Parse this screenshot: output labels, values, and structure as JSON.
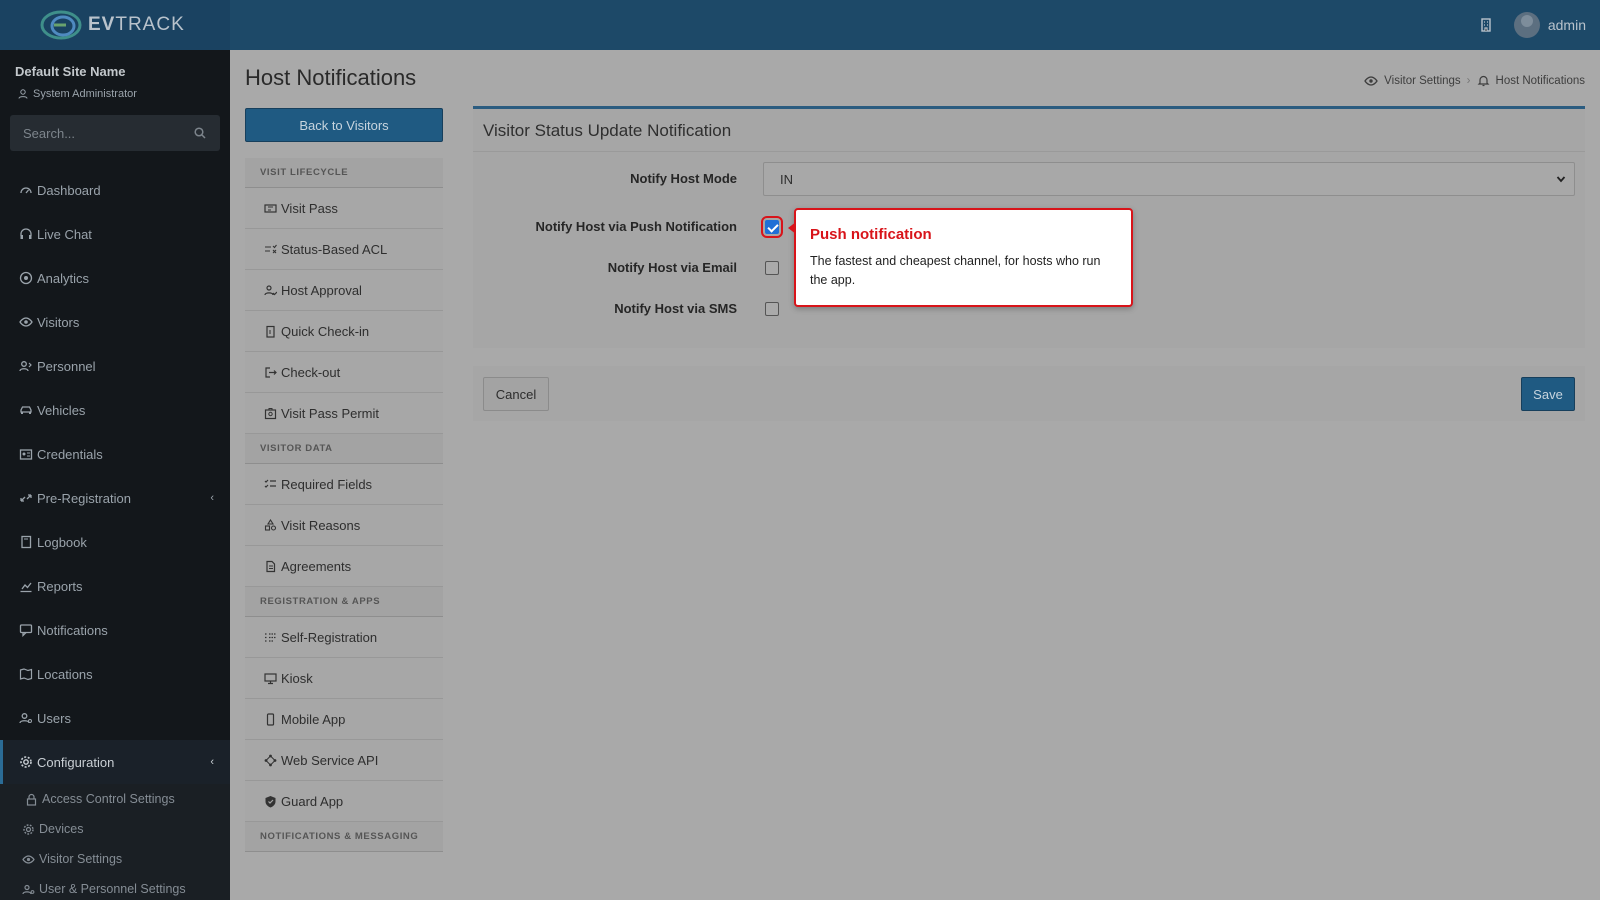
{
  "header": {
    "logo_text_bold": "EV",
    "logo_text_thin": "TRACK",
    "user_name": "admin"
  },
  "sidebar": {
    "site_name": "Default Site Name",
    "site_role": "System Administrator",
    "search_placeholder": "Search...",
    "items": [
      {
        "label": "Dashboard"
      },
      {
        "label": "Live Chat"
      },
      {
        "label": "Analytics"
      },
      {
        "label": "Visitors"
      },
      {
        "label": "Personnel"
      },
      {
        "label": "Vehicles"
      },
      {
        "label": "Credentials"
      },
      {
        "label": "Pre-Registration"
      },
      {
        "label": "Logbook"
      },
      {
        "label": "Reports"
      },
      {
        "label": "Notifications"
      },
      {
        "label": "Locations"
      },
      {
        "label": "Users"
      },
      {
        "label": "Configuration"
      }
    ],
    "config_sub": [
      {
        "label": "Access Control Settings"
      },
      {
        "label": "Devices"
      },
      {
        "label": "Visitor Settings"
      },
      {
        "label": "User & Personnel Settings"
      }
    ]
  },
  "page": {
    "title": "Host Notifications",
    "back_label": "Back to Visitors",
    "breadcrumb": [
      "Visitor Settings",
      "Host Notifications"
    ]
  },
  "submenu": {
    "sections": [
      {
        "heading": "VISIT LIFECYCLE",
        "items": [
          "Visit Pass",
          "Status-Based ACL",
          "Host Approval",
          "Quick Check-in",
          "Check-out",
          "Visit Pass Permit"
        ]
      },
      {
        "heading": "VISITOR DATA",
        "items": [
          "Required Fields",
          "Visit Reasons",
          "Agreements"
        ]
      },
      {
        "heading": "REGISTRATION & APPS",
        "items": [
          "Self-Registration",
          "Kiosk",
          "Mobile App",
          "Web Service API",
          "Guard App"
        ]
      },
      {
        "heading": "NOTIFICATIONS & MESSAGING",
        "items": []
      }
    ]
  },
  "form": {
    "card_title": "Visitor Status Update Notification",
    "mode_label": "Notify Host Mode",
    "mode_value": "IN",
    "push_label": "Notify Host via Push Notification",
    "push_checked": true,
    "email_label": "Notify Host via Email",
    "email_checked": false,
    "sms_label": "Notify Host via SMS",
    "sms_checked": false,
    "cancel_label": "Cancel",
    "save_label": "Save"
  },
  "callout": {
    "title": "Push notification",
    "body": "The fastest and cheapest channel, for hosts who run the app."
  },
  "colors": {
    "accent": "#1f5a82",
    "callout_red": "#d8141a"
  }
}
